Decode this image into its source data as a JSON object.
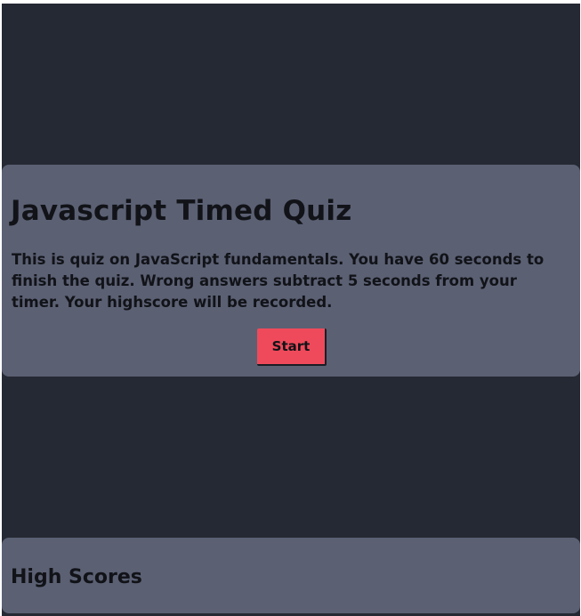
{
  "quiz": {
    "title": "Javascript Timed Quiz",
    "description": "This is quiz on JavaScript fundamentals. You have 60 seconds to finish the quiz. Wrong answers subtract 5 seconds from your timer. Your highscore will be recorded.",
    "start_label": "Start"
  },
  "high_scores": {
    "title": "High Scores"
  },
  "colors": {
    "background": "#252933",
    "card": "#5b6073",
    "accent": "#ef4a5b",
    "text": "#111318"
  }
}
